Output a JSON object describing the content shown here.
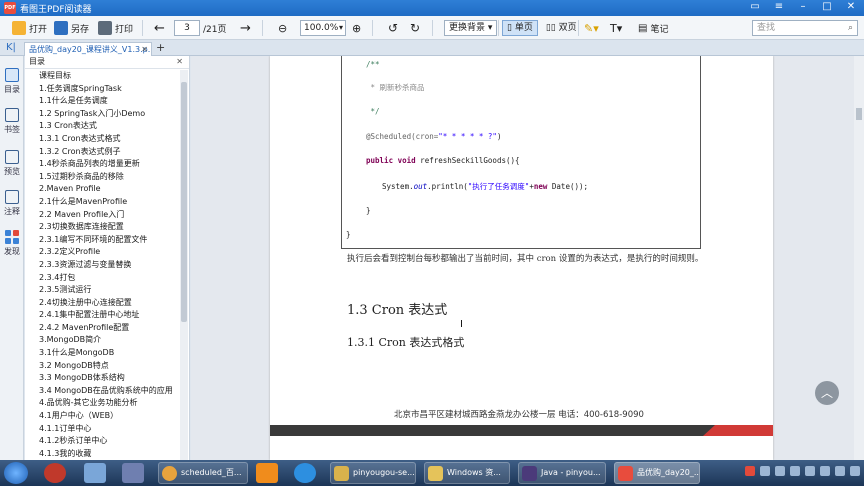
{
  "window": {
    "title": "看图王PDF阅读器",
    "app_icon_text": "PDF"
  },
  "toolbar": {
    "open": "打开",
    "save_as": "另存",
    "print": "打印",
    "current_page": "3",
    "total_pages": "/21页",
    "zoom": "100.0%",
    "background_label": "更换背景",
    "single_page": "单页",
    "double_page": "双页",
    "notes": "笔记",
    "search_placeholder": "查找"
  },
  "tabs": [
    {
      "label": "品优购_day20_课程讲义_V1.3.p..."
    }
  ],
  "rail": [
    {
      "label": "目录"
    },
    {
      "label": "书签"
    },
    {
      "label": "预览"
    },
    {
      "label": "注释"
    },
    {
      "label": "发现"
    }
  ],
  "outline": {
    "heading": "目录",
    "items": [
      "课程目标",
      "1.任务调度SpringTask",
      "1.1什么是任务调度",
      "1.2 SpringTask入门小Demo",
      "1.3 Cron表达式",
      "1.3.1 Cron表达式格式",
      "1.3.2 Cron表达式例子",
      "1.4秒杀商品列表的增量更新",
      "1.5过期秒杀商品的移除",
      "2.Maven Profile",
      "2.1什么是MavenProfile",
      "2.2 Maven Profile入门",
      "2.3切换数据库连接配置",
      "2.3.1编写不同环境的配置文件",
      "2.3.2定义Profile",
      "2.3.3资源过滤与变量替换",
      "2.3.4打包",
      "2.3.5测试运行",
      "2.4切换注册中心连接配置",
      "2.4.1集中配置注册中心地址",
      "2.4.2 MavenProfile配置",
      "3.MongoDB简介",
      "3.1什么是MongoDB",
      "3.2 MongoDB特点",
      "3.3 MongoDB体系结构",
      "3.4 MongoDB在品优购系统中的应用",
      "4.品优购-其它业务功能分析",
      "4.1用户中心（WEB）",
      "4.1.1订单中心",
      "4.1.2秒杀订单中心",
      "4.1.3我的收藏"
    ]
  },
  "document": {
    "code": {
      "l1": "/**",
      "l2": " * 刷新秒杀商品",
      "l3": " */",
      "l4_anno": "@Scheduled(cron=",
      "l4_str": "\"* * * * * ?\"",
      "l4_end": ")",
      "l5_kw": "public void",
      "l5_rest": " refreshSeckillGoods(){",
      "l6_a": "System.",
      "l6_field": "out",
      "l6_b": ".println(",
      "l6_str": "\"执行了任务调度\"",
      "l6_c": "+",
      "l6_kw": "new",
      "l6_d": " Date());",
      "l7": "}",
      "l8": "}"
    },
    "paragraph": "执行后会看到控制台每秒都输出了当前时间，其中 cron 设置的为表达式，是执行的时间规则。",
    "heading_2": "1.3 Cron 表达式",
    "heading_3": "1.3.1 Cron 表达式格式",
    "footer": "北京市昌平区建材城西路金燕龙办公楼一层     电话：400-618-9090"
  },
  "taskbar": {
    "tasks": [
      {
        "label": "scheduled_百..."
      },
      {
        "label": "pinyougou-se..."
      },
      {
        "label": "Windows 资..."
      },
      {
        "label": "Java - pinyou..."
      },
      {
        "label": "品优购_day20_..."
      }
    ]
  },
  "colors": {
    "accent": "#2f7fd6",
    "code_keyword": "#7f0055",
    "code_string": "#2a00ff",
    "footer_red": "#d13a36"
  }
}
